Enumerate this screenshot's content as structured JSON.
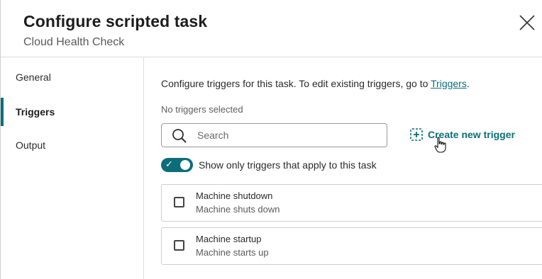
{
  "header": {
    "title": "Configure scripted task",
    "subtitle": "Cloud Health Check"
  },
  "sidebar": {
    "items": [
      {
        "label": "General"
      },
      {
        "label": "Triggers",
        "active": true
      },
      {
        "label": "Output"
      }
    ]
  },
  "main": {
    "intro_text": "Configure triggers for this task. To edit existing triggers, go to ",
    "intro_link": "Triggers",
    "intro_end": ".",
    "selected_note": "No triggers selected",
    "search": {
      "placeholder": "Search",
      "value": ""
    },
    "create_label": "Create new trigger",
    "toggle": {
      "label": "Show only triggers that apply to this task",
      "on": true
    },
    "triggers": [
      {
        "name": "Machine shutdown",
        "description": "Machine shuts down",
        "checked": false
      },
      {
        "name": "Machine startup",
        "description": "Machine starts up",
        "checked": false
      }
    ]
  },
  "colors": {
    "accent": "#0b6e79"
  }
}
